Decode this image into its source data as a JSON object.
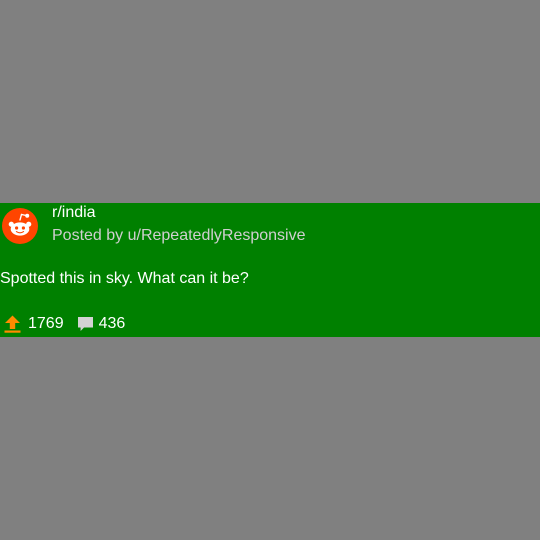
{
  "post": {
    "subreddit": "r/india",
    "posted_by": "Posted by u/RepeatedlyResponsive",
    "title": "Spotted this in sky. What can it be?",
    "upvotes": "1769",
    "comments": "436"
  },
  "icons": {
    "avatar": "reddit-logo-icon",
    "upvote": "upvote-arrow-icon",
    "comment": "comment-bubble-icon"
  },
  "colors": {
    "page_background": "#808080",
    "card_background": "#008000",
    "primary_text": "#ffffff",
    "secondary_text": "#cfcfcf",
    "reddit_orange": "#ff4500",
    "upvote_orange": "#ff8b00",
    "comment_icon": "#d3d3d3"
  }
}
